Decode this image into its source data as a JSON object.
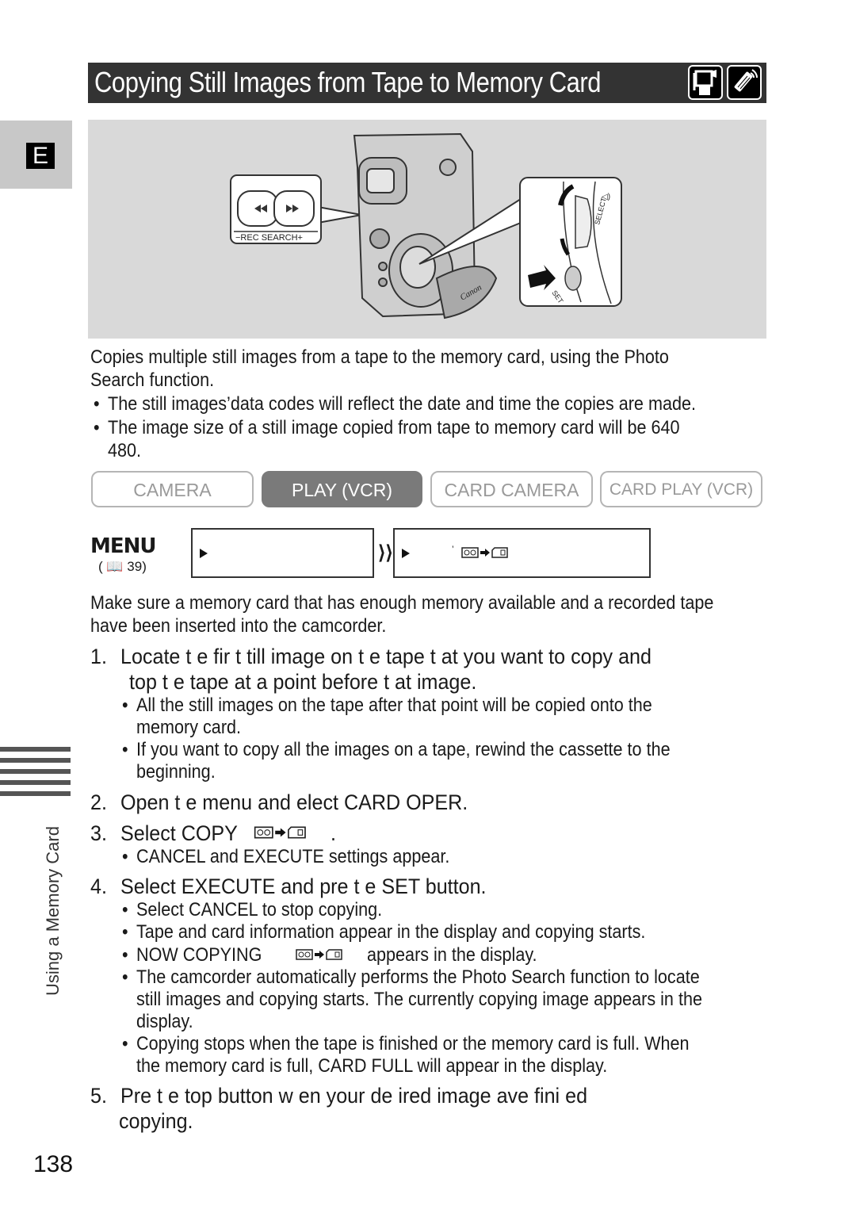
{
  "header": {
    "title": "Copying Still Images from Tape to Memory Card",
    "icons": [
      "camcorder-icon",
      "remote-control-icon"
    ]
  },
  "side_tab": {
    "letter": "E"
  },
  "illustration": {
    "rec_search_label": "−REC SEARCH+",
    "select_label": "SELECT",
    "set_label": "SET",
    "brand": "Canon"
  },
  "intro": {
    "line1": "Copies multiple still images from a tape to the memory card, using the Photo",
    "line2": "Search function.",
    "bullets": [
      "The still images’data codes will reflect the date and time the copies are made.",
      "The image size of a still image copied from tape to memory card will be 640",
      "480."
    ]
  },
  "modes": [
    {
      "label": "CAMERA",
      "active": false
    },
    {
      "label": "PLAY (VCR)",
      "active": true
    },
    {
      "label": "CARD CAMERA",
      "active": false
    },
    {
      "label": "CARD PLAY (VCR)",
      "active": false
    }
  ],
  "menu": {
    "label": "MENU",
    "ref": "( 🕮 39)",
    "ref_page": "39",
    "box2_text": "’"
  },
  "prereq": {
    "line1": "Make sure a memory card that has enough memory available and a recorded tape",
    "line2": "have been inserted into the camcorder."
  },
  "steps": [
    {
      "num": "1.",
      "lines": [
        "Locate t  e fir  t   till image on t  e tape t  at you want to copy and",
        "top t  e tape at a point before t  at image."
      ],
      "bullets": [
        [
          "All the still images on the tape after that point will be copied onto the",
          "memory card."
        ],
        [
          "If you want to copy all the images on a tape, rewind the cassette to the",
          "beginning."
        ]
      ]
    },
    {
      "num": "2.",
      "lines": [
        "Open t  e menu and   elect CARD OPER."
      ],
      "bullets": []
    },
    {
      "num": "3.",
      "lines": [
        "Select COPY"
      ],
      "suffix": ".",
      "bullets": [
        [
          "CANCEL and EXECUTE settings appear."
        ]
      ]
    },
    {
      "num": "4.",
      "lines": [
        "Select EXECUTE and pre     t  e SET button."
      ],
      "bullets": [
        [
          "Select CANCEL to stop copying."
        ],
        [
          "Tape and card information appear in the display and copying starts."
        ],
        [
          "NOW COPYING",
          "appears in the display."
        ],
        [
          "The camcorder automatically performs the Photo Search function to locate",
          "still images and copying starts. The currently copying image appears in the",
          "display."
        ],
        [
          "Copying stops when the tape is finished or the memory card is full. When",
          "the memory card is full, CARD FULL will appear in the display."
        ]
      ]
    },
    {
      "num": "5.",
      "lines": [
        "Pre     t  e   top button w  en your de  ired image     ave fini     ed",
        "copying."
      ],
      "bullets": []
    }
  ],
  "sidebar": {
    "section_label": "Using a Memory Card"
  },
  "footer": {
    "page_number": "138"
  }
}
